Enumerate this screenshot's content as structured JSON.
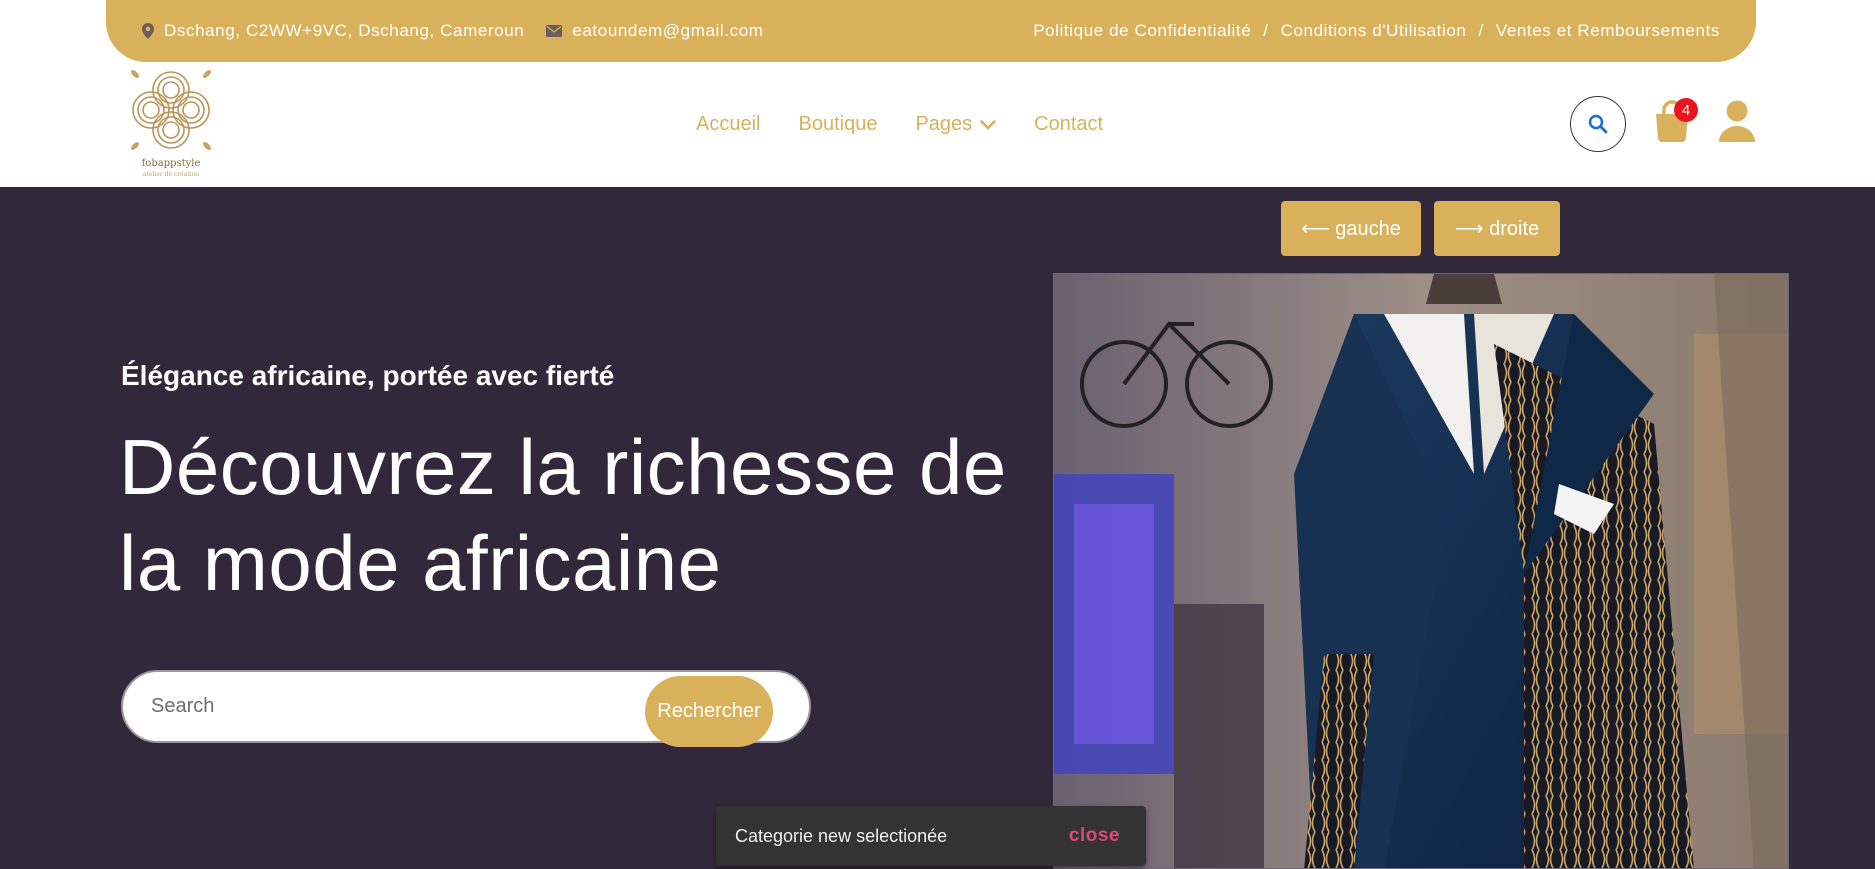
{
  "topbar": {
    "address": "Dschang, C2WW+9VC, Dschang, Cameroun",
    "email": "eatoundem@gmail.com",
    "links": [
      "Politique de Confidentialité",
      "Conditions d'Utilisation",
      "Ventes et Remboursements"
    ],
    "separator": "/"
  },
  "logo": {
    "name": "fobappstyle",
    "tagline": "atelier de création"
  },
  "nav": {
    "items": [
      "Accueil",
      "Boutique",
      "Pages",
      "Contact"
    ]
  },
  "cart": {
    "count": "4"
  },
  "hero": {
    "subtitle": "Élégance africaine, portée avec fierté",
    "headline": "Découvrez la richesse de la mode africaine",
    "search_placeholder": "Search",
    "search_button": "Rechercher",
    "prev_button": "⟵ gauche",
    "next_button": "⟶ droite"
  },
  "snackbar": {
    "message": "Categorie new selectionée",
    "action": "close"
  },
  "colors": {
    "accent": "#d9b15a",
    "hero_bg": "#31293b",
    "badge": "#e8161c",
    "snackbar_bg": "#333333",
    "snackbar_action": "#e0457b"
  },
  "icons": [
    "map-marker-icon",
    "envelope-icon",
    "chevron-down-icon",
    "search-icon",
    "shopping-bag-icon",
    "user-icon"
  ]
}
